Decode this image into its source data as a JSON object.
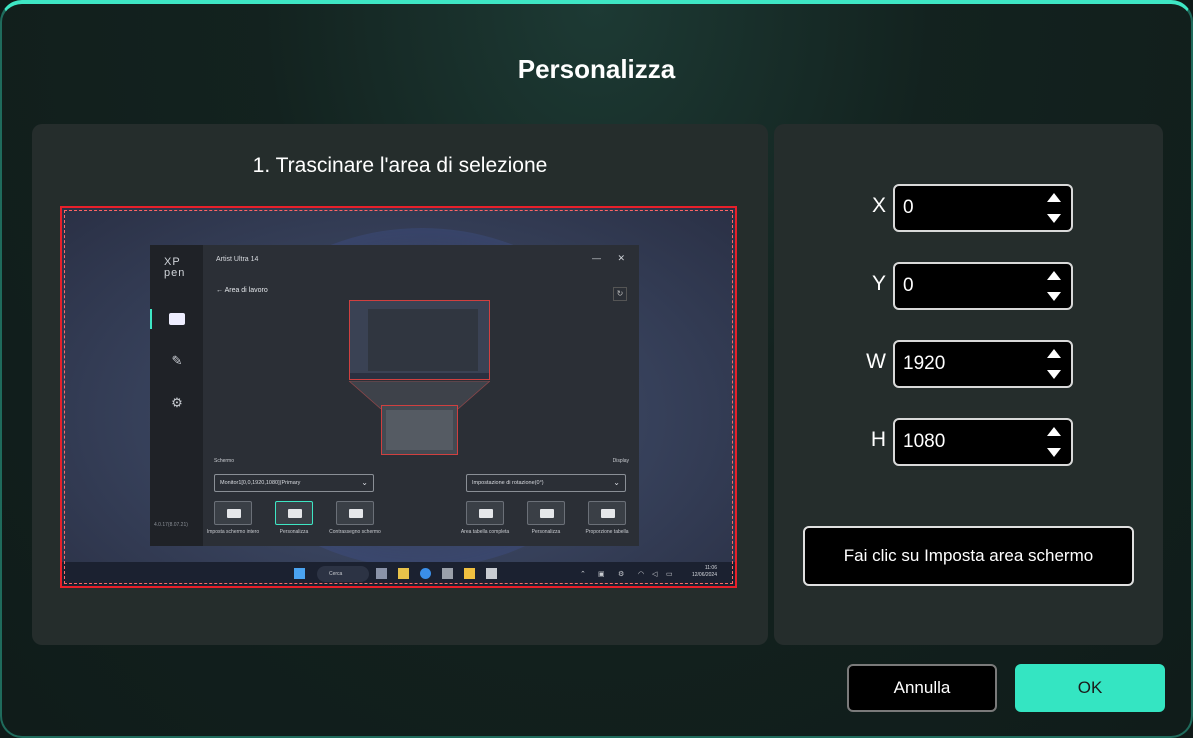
{
  "dialog": {
    "title": "Personalizza",
    "step_label": "1. Trascinare l'area di selezione",
    "accent_color": "#34e5c2",
    "selection_color": "#e8202a"
  },
  "preview": {
    "app_logo_line1": "XP",
    "app_logo_line2": "pen",
    "app_title": "Artist Ultra 14",
    "app_subtitle": "Area di lavoro",
    "back_icon": "arrow-left-icon",
    "section_left": "Schermo",
    "section_right": "Display",
    "monitor_select": "Monitor1[0,0,1920,1080](Primary",
    "rotation_select": "Impostazione di rotazione(0°)",
    "left_options": [
      "Imposta schermo intero",
      "Personalizza",
      "Contrassegno schermo"
    ],
    "right_options": [
      "Area tabella completa",
      "Personalizza",
      "Proporzione tabella"
    ],
    "version": "4.0.17(8.07.21)",
    "taskbar_search": "Cerca",
    "clock_time": "11:06",
    "clock_date": "12/06/2024"
  },
  "fields": [
    {
      "label": "X",
      "value": "0"
    },
    {
      "label": "Y",
      "value": "0"
    },
    {
      "label": "W",
      "value": "1920"
    },
    {
      "label": "H",
      "value": "1080"
    }
  ],
  "set_area_button": "Fai clic su Imposta area schermo",
  "buttons": {
    "cancel": "Annulla",
    "ok": "OK"
  }
}
